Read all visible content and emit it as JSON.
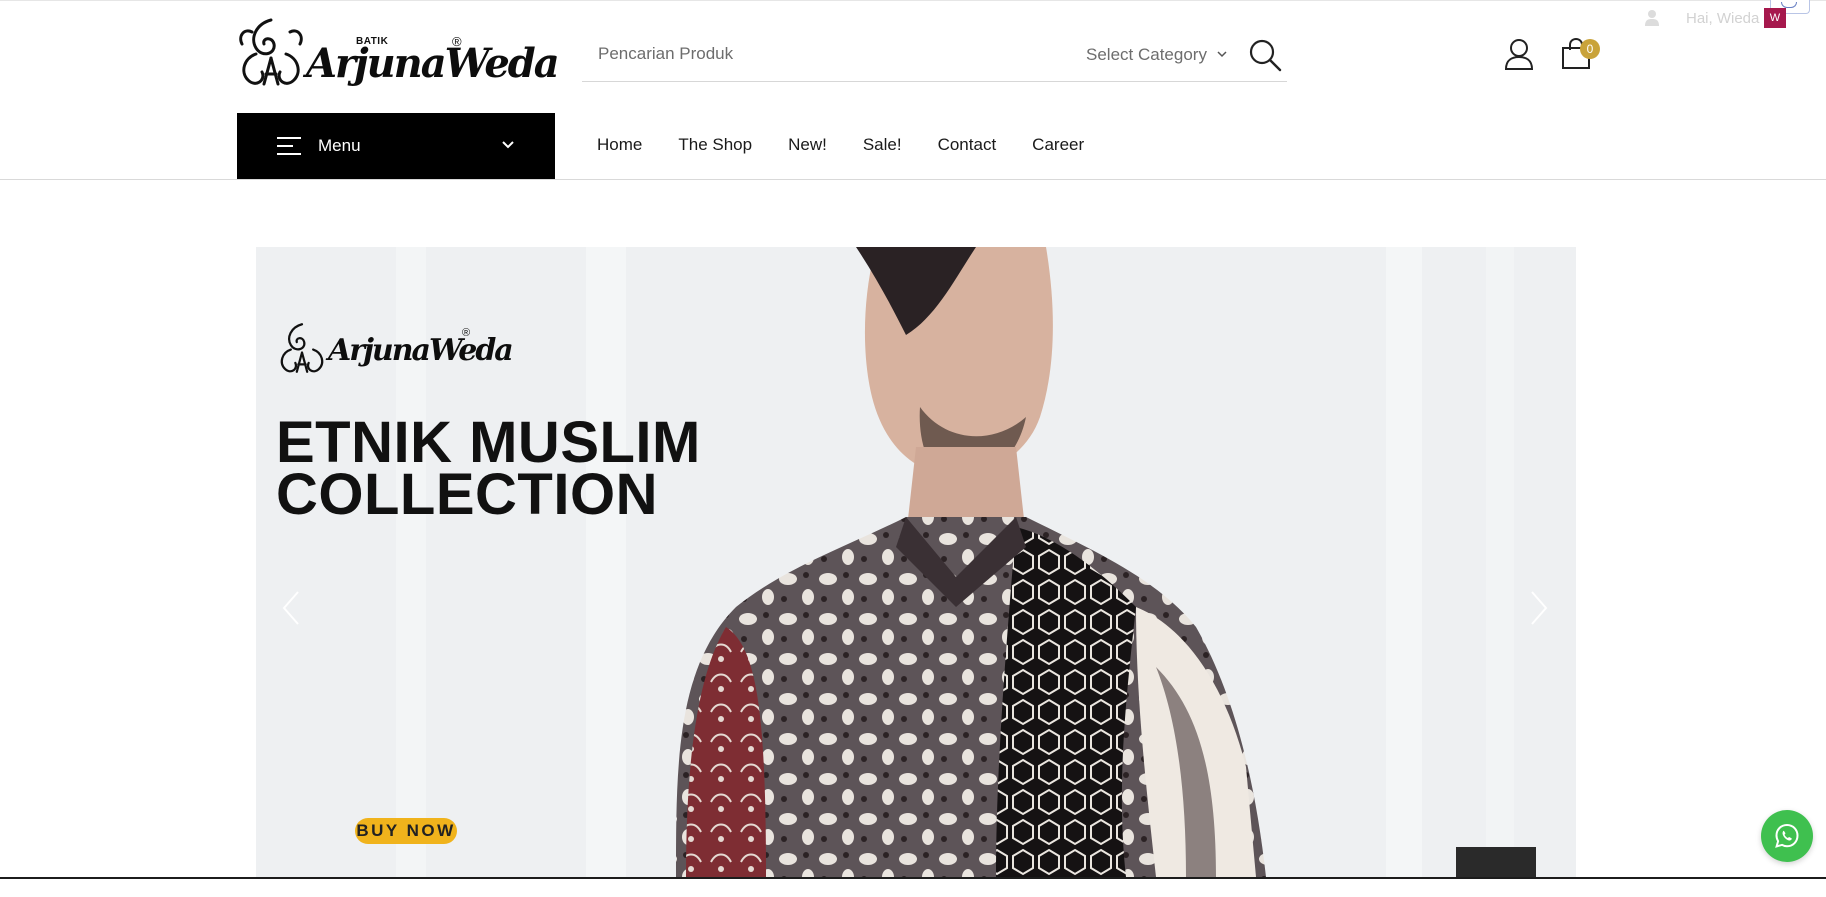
{
  "brand": {
    "name": "ArjunaWeda",
    "prefix": "BATIK",
    "registered": "®"
  },
  "search": {
    "placeholder": "Pencarian Produk",
    "category_label": "Select Category"
  },
  "cart": {
    "count": "0"
  },
  "account": {
    "greeting": "Hai, Wieda",
    "badge": "W"
  },
  "menu": {
    "label": "Menu"
  },
  "nav": {
    "items": [
      {
        "label": "Home"
      },
      {
        "label": "The Shop"
      },
      {
        "label": "New!"
      },
      {
        "label": "Sale!"
      },
      {
        "label": "Contact"
      },
      {
        "label": "Career"
      }
    ]
  },
  "hero": {
    "logo_text": "ArjunaWeda",
    "headline_line1": "ETNIK MUSLIM",
    "headline_line2": "COLLECTION",
    "cta": "BUY NOW"
  },
  "colors": {
    "accent": "#f0b31c",
    "cart_badge": "#c9a33a",
    "whatsapp": "#3fc04f",
    "menu_bar": "#000000"
  },
  "icons": {
    "user": "user-icon",
    "cart": "shopping-bag-icon",
    "search": "search-icon",
    "menu": "hamburger-icon",
    "whatsapp": "whatsapp-icon",
    "prev": "chevron-left-icon",
    "next": "chevron-right-icon"
  }
}
